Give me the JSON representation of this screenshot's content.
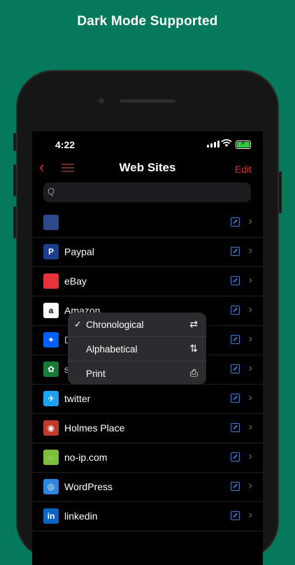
{
  "promo": {
    "headline": "Dark Mode Supported"
  },
  "status_bar": {
    "time": "4:22"
  },
  "nav": {
    "back_icon": "chevron-left-icon",
    "title": "Web Sites",
    "edit_label": "Edit"
  },
  "search": {
    "glyph": "Q"
  },
  "sort_menu": {
    "items": [
      {
        "label": "Chronological",
        "checked": true,
        "icon": "shuffle-icon",
        "glyph": "⇄"
      },
      {
        "label": "Alphabetical",
        "checked": false,
        "icon": "sort-arrows-icon",
        "glyph": "⇅"
      },
      {
        "label": "Print",
        "checked": false,
        "icon": "printer-icon",
        "glyph": "⎙"
      }
    ]
  },
  "sites": [
    {
      "name": "",
      "icon_color": "#2c4a8a",
      "glyph": ""
    },
    {
      "name": "Paypal",
      "icon_color": "#1b3f8f",
      "glyph": "P"
    },
    {
      "name": "eBay",
      "icon_color": "#e53238",
      "glyph": ""
    },
    {
      "name": "Amazon",
      "icon_color": "#ffffff",
      "glyph": "a"
    },
    {
      "name": "DropBox",
      "icon_color": "#0061fe",
      "glyph": "✦"
    },
    {
      "name": "sugersync",
      "icon_color": "#1a7a3a",
      "glyph": "✿"
    },
    {
      "name": "twitter",
      "icon_color": "#1da1f2",
      "glyph": "✈"
    },
    {
      "name": "Holmes Place",
      "icon_color": "#c0392b",
      "glyph": "◉"
    },
    {
      "name": "no-ip.com",
      "icon_color": "#7bbf3a",
      "glyph": "◌"
    },
    {
      "name": "WordPress",
      "icon_color": "#2e86de",
      "glyph": "◎"
    },
    {
      "name": "linkedin",
      "icon_color": "#0a66c2",
      "glyph": "in"
    }
  ]
}
